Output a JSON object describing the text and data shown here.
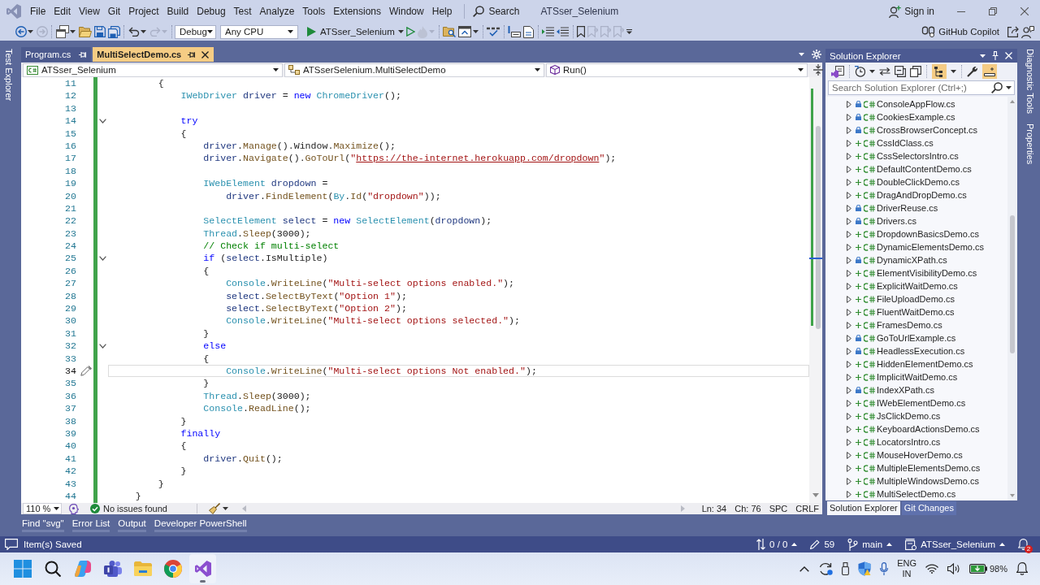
{
  "window": {
    "title": "ATSser_Selenium"
  },
  "menu": [
    "File",
    "Edit",
    "View",
    "Git",
    "Project",
    "Build",
    "Debug",
    "Test",
    "Analyze",
    "Tools",
    "Extensions",
    "Window",
    "Help"
  ],
  "search": {
    "label": "Search"
  },
  "account": {
    "label": "Sign in"
  },
  "toolbar": {
    "configuration": "Debug",
    "platform": "Any CPU",
    "start": "ATSser_Selenium",
    "copilot": "GitHub Copilot"
  },
  "side_tabs": {
    "left": [
      "Test Explorer"
    ],
    "right": [
      "Diagnostic Tools",
      "Properties"
    ]
  },
  "editor": {
    "tabs": [
      {
        "label": "Program.cs",
        "selected": false
      },
      {
        "label": "MultiSelectDemo.cs",
        "selected": true
      }
    ],
    "navigation": {
      "project": "ATSser_Selenium",
      "type": "ATSserSelenium.MultiSelectDemo",
      "member": "Run()"
    },
    "lines": [
      {
        "number": "11",
        "current": false,
        "tokens": [
          {
            "kind": "plain",
            "text": "        {"
          }
        ]
      },
      {
        "number": "12",
        "current": false,
        "tokens": [
          {
            "kind": "type",
            "text": "            IWebDriver"
          },
          {
            "kind": "variable",
            "text": " driver"
          },
          {
            "kind": "plain",
            "text": " = "
          },
          {
            "kind": "keyword",
            "text": "new"
          },
          {
            "kind": "type",
            "text": " ChromeDriver"
          },
          {
            "kind": "plain",
            "text": "();"
          }
        ]
      },
      {
        "number": "13",
        "current": false
      },
      {
        "number": "14",
        "current": false,
        "expanded": true,
        "tokens": [
          {
            "kind": "keyword",
            "text": "            try"
          }
        ]
      },
      {
        "number": "15",
        "current": false,
        "tokens": [
          {
            "kind": "plain",
            "text": "            {"
          }
        ]
      },
      {
        "number": "16",
        "current": false,
        "tokens": [
          {
            "kind": "variable",
            "text": "                driver"
          },
          {
            "kind": "plain",
            "text": "."
          },
          {
            "kind": "method",
            "text": "Manage"
          },
          {
            "kind": "plain",
            "text": "().Window."
          },
          {
            "kind": "method",
            "text": "Maximize"
          },
          {
            "kind": "plain",
            "text": "();"
          }
        ]
      },
      {
        "number": "17",
        "current": false,
        "tokens": [
          {
            "kind": "variable",
            "text": "                driver"
          },
          {
            "kind": "plain",
            "text": "."
          },
          {
            "kind": "method",
            "text": "Navigate"
          },
          {
            "kind": "plain",
            "text": "()."
          },
          {
            "kind": "method",
            "text": "GoToUrl"
          },
          {
            "kind": "plain",
            "text": "("
          },
          {
            "kind": "string",
            "text": "\""
          },
          {
            "kind": "url",
            "text": "https://the-internet.herokuapp.com/dropdown"
          },
          {
            "kind": "string",
            "text": "\""
          },
          {
            "kind": "plain",
            "text": ");"
          }
        ]
      },
      {
        "number": "18",
        "current": false
      },
      {
        "number": "19",
        "current": false,
        "tokens": [
          {
            "kind": "type",
            "text": "                IWebElement"
          },
          {
            "kind": "variable",
            "text": " dropdown"
          },
          {
            "kind": "plain",
            "text": " ="
          }
        ]
      },
      {
        "number": "20",
        "current": false,
        "tokens": [
          {
            "kind": "variable",
            "text": "                    driver"
          },
          {
            "kind": "plain",
            "text": "."
          },
          {
            "kind": "method",
            "text": "FindElement"
          },
          {
            "kind": "plain",
            "text": "("
          },
          {
            "kind": "type",
            "text": "By"
          },
          {
            "kind": "plain",
            "text": "."
          },
          {
            "kind": "method",
            "text": "Id"
          },
          {
            "kind": "plain",
            "text": "("
          },
          {
            "kind": "string",
            "text": "\"dropdown\""
          },
          {
            "kind": "plain",
            "text": "));"
          }
        ]
      },
      {
        "number": "21",
        "current": false
      },
      {
        "number": "22",
        "current": false,
        "tokens": [
          {
            "kind": "type",
            "text": "                SelectElement"
          },
          {
            "kind": "variable",
            "text": " select"
          },
          {
            "kind": "plain",
            "text": " = "
          },
          {
            "kind": "keyword",
            "text": "new"
          },
          {
            "kind": "type",
            "text": " SelectElement"
          },
          {
            "kind": "plain",
            "text": "("
          },
          {
            "kind": "variable",
            "text": "dropdown"
          },
          {
            "kind": "plain",
            "text": ");"
          }
        ]
      },
      {
        "number": "23",
        "current": false,
        "tokens": [
          {
            "kind": "type",
            "text": "                Thread"
          },
          {
            "kind": "plain",
            "text": "."
          },
          {
            "kind": "method",
            "text": "Sleep"
          },
          {
            "kind": "plain",
            "text": "("
          },
          {
            "kind": "number",
            "text": "3000"
          },
          {
            "kind": "plain",
            "text": ");"
          }
        ]
      },
      {
        "number": "24",
        "current": false,
        "tokens": [
          {
            "kind": "comment",
            "text": "                // Check if multi-select"
          }
        ]
      },
      {
        "number": "25",
        "current": false,
        "expanded": true,
        "tokens": [
          {
            "kind": "keyword",
            "text": "                if"
          },
          {
            "kind": "plain",
            "text": " ("
          },
          {
            "kind": "variable",
            "text": "select"
          },
          {
            "kind": "plain",
            "text": ".IsMultiple)"
          }
        ]
      },
      {
        "number": "26",
        "current": false,
        "tokens": [
          {
            "kind": "plain",
            "text": "                {"
          }
        ]
      },
      {
        "number": "27",
        "current": false,
        "tokens": [
          {
            "kind": "type",
            "text": "                    Console"
          },
          {
            "kind": "plain",
            "text": "."
          },
          {
            "kind": "method",
            "text": "WriteLine"
          },
          {
            "kind": "plain",
            "text": "("
          },
          {
            "kind": "string",
            "text": "\"Multi-select options enabled.\""
          },
          {
            "kind": "plain",
            "text": ");"
          }
        ]
      },
      {
        "number": "28",
        "current": false,
        "tokens": [
          {
            "kind": "variable",
            "text": "                    select"
          },
          {
            "kind": "plain",
            "text": "."
          },
          {
            "kind": "method",
            "text": "SelectByText"
          },
          {
            "kind": "plain",
            "text": "("
          },
          {
            "kind": "string",
            "text": "\"Option 1\""
          },
          {
            "kind": "plain",
            "text": ");"
          }
        ]
      },
      {
        "number": "29",
        "current": false,
        "tokens": [
          {
            "kind": "variable",
            "text": "                    select"
          },
          {
            "kind": "plain",
            "text": "."
          },
          {
            "kind": "method",
            "text": "SelectByText"
          },
          {
            "kind": "plain",
            "text": "("
          },
          {
            "kind": "string",
            "text": "\"Option 2\""
          },
          {
            "kind": "plain",
            "text": ");"
          }
        ]
      },
      {
        "number": "30",
        "current": false,
        "tokens": [
          {
            "kind": "type",
            "text": "                    Console"
          },
          {
            "kind": "plain",
            "text": "."
          },
          {
            "kind": "method",
            "text": "WriteLine"
          },
          {
            "kind": "plain",
            "text": "("
          },
          {
            "kind": "string",
            "text": "\"Multi-select options selected.\""
          },
          {
            "kind": "plain",
            "text": ");"
          }
        ]
      },
      {
        "number": "31",
        "current": false,
        "tokens": [
          {
            "kind": "plain",
            "text": "                }"
          }
        ]
      },
      {
        "number": "32",
        "current": false,
        "expanded": true,
        "tokens": [
          {
            "kind": "keyword",
            "text": "                else"
          }
        ]
      },
      {
        "number": "33",
        "current": false,
        "tokens": [
          {
            "kind": "plain",
            "text": "                {"
          }
        ]
      },
      {
        "number": "34",
        "current": true,
        "tokens": [
          {
            "kind": "type",
            "text": "                    Console"
          },
          {
            "kind": "plain",
            "text": "."
          },
          {
            "kind": "method",
            "text": "WriteLine"
          },
          {
            "kind": "plain",
            "text": "("
          },
          {
            "kind": "string",
            "text": "\"Multi-select options Not enabled.\""
          },
          {
            "kind": "plain",
            "text": ");"
          }
        ]
      },
      {
        "number": "35",
        "current": false,
        "tokens": [
          {
            "kind": "plain",
            "text": "                }"
          }
        ]
      },
      {
        "number": "36",
        "current": false,
        "tokens": [
          {
            "kind": "type",
            "text": "                Thread"
          },
          {
            "kind": "plain",
            "text": "."
          },
          {
            "kind": "method",
            "text": "Sleep"
          },
          {
            "kind": "plain",
            "text": "("
          },
          {
            "kind": "number",
            "text": "3000"
          },
          {
            "kind": "plain",
            "text": ");"
          }
        ]
      },
      {
        "number": "37",
        "current": false,
        "tokens": [
          {
            "kind": "type",
            "text": "                Console"
          },
          {
            "kind": "plain",
            "text": "."
          },
          {
            "kind": "method",
            "text": "ReadLine"
          },
          {
            "kind": "plain",
            "text": "();"
          }
        ]
      },
      {
        "number": "38",
        "current": false,
        "tokens": [
          {
            "kind": "plain",
            "text": "            }"
          }
        ]
      },
      {
        "number": "39",
        "current": false,
        "tokens": [
          {
            "kind": "keyword",
            "text": "            finally"
          }
        ]
      },
      {
        "number": "40",
        "current": false,
        "tokens": [
          {
            "kind": "plain",
            "text": "            {"
          }
        ]
      },
      {
        "number": "41",
        "current": false,
        "tokens": [
          {
            "kind": "variable",
            "text": "                driver"
          },
          {
            "kind": "plain",
            "text": "."
          },
          {
            "kind": "method",
            "text": "Quit"
          },
          {
            "kind": "plain",
            "text": "();"
          }
        ]
      },
      {
        "number": "42",
        "current": false,
        "tokens": [
          {
            "kind": "plain",
            "text": "            }"
          }
        ]
      },
      {
        "number": "43",
        "current": false,
        "tokens": [
          {
            "kind": "plain",
            "text": "        }"
          }
        ]
      },
      {
        "number": "44",
        "current": false,
        "tokens": [
          {
            "kind": "plain",
            "text": "    }"
          }
        ]
      }
    ],
    "status": {
      "zoom": "110 %",
      "issues": "No issues found",
      "line": "Ln: 34",
      "column": "Ch: 76",
      "whitespace": "SPC",
      "line_endings": "CRLF"
    }
  },
  "solution_explorer": {
    "title": "Solution Explorer",
    "search": {
      "placeholder": "Search Solution Explorer (Ctrl+;)"
    },
    "items": [
      {
        "name": "ConsoleAppFlow.cs",
        "kind": "unchanged",
        "expanded": false
      },
      {
        "name": "CookiesExample.cs",
        "kind": "unchanged",
        "expanded": false
      },
      {
        "name": "CrossBrowserConcept.cs",
        "kind": "unchanged",
        "expanded": false
      },
      {
        "name": "CssIdClass.cs",
        "kind": "added",
        "expanded": false
      },
      {
        "name": "CssSelectorsIntro.cs",
        "kind": "added",
        "expanded": false
      },
      {
        "name": "DefaultContentDemo.cs",
        "kind": "added",
        "expanded": false
      },
      {
        "name": "DoubleClickDemo.cs",
        "kind": "added",
        "expanded": false
      },
      {
        "name": "DragAndDropDemo.cs",
        "kind": "added",
        "expanded": false
      },
      {
        "name": "DriverReuse.cs",
        "kind": "unchanged",
        "expanded": false
      },
      {
        "name": "Drivers.cs",
        "kind": "unchanged",
        "expanded": false
      },
      {
        "name": "DropdownBasicsDemo.cs",
        "kind": "added",
        "expanded": false
      },
      {
        "name": "DynamicElementsDemo.cs",
        "kind": "added",
        "expanded": false
      },
      {
        "name": "DynamicXPath.cs",
        "kind": "unchanged",
        "expanded": false
      },
      {
        "name": "ElementVisibilityDemo.cs",
        "kind": "added",
        "expanded": false
      },
      {
        "name": "ExplicitWaitDemo.cs",
        "kind": "added",
        "expanded": false
      },
      {
        "name": "FileUploadDemo.cs",
        "kind": "added",
        "expanded": false
      },
      {
        "name": "FluentWaitDemo.cs",
        "kind": "added",
        "expanded": false
      },
      {
        "name": "FramesDemo.cs",
        "kind": "added",
        "expanded": false
      },
      {
        "name": "GoToUrlExample.cs",
        "kind": "unchanged",
        "expanded": false
      },
      {
        "name": "HeadlessExecution.cs",
        "kind": "unchanged",
        "expanded": false
      },
      {
        "name": "HiddenElementDemo.cs",
        "kind": "added",
        "expanded": false
      },
      {
        "name": "ImplicitWaitDemo.cs",
        "kind": "added",
        "expanded": false
      },
      {
        "name": "IndexXPath.cs",
        "kind": "unchanged",
        "expanded": false
      },
      {
        "name": "IWebElementDemo.cs",
        "kind": "added",
        "expanded": false
      },
      {
        "name": "JsClickDemo.cs",
        "kind": "added",
        "expanded": false
      },
      {
        "name": "KeyboardActionsDemo.cs",
        "kind": "added",
        "expanded": false
      },
      {
        "name": "LocatorsIntro.cs",
        "kind": "added",
        "expanded": false
      },
      {
        "name": "MouseHoverDemo.cs",
        "kind": "added",
        "expanded": false
      },
      {
        "name": "MultipleElementsDemo.cs",
        "kind": "added",
        "expanded": false
      },
      {
        "name": "MultipleWindowsDemo.cs",
        "kind": "added",
        "expanded": false
      },
      {
        "name": "MultiSelectDemo.cs",
        "kind": "added",
        "expanded": false
      }
    ],
    "tabs": [
      {
        "label": "Solution Explorer",
        "selected": true
      },
      {
        "label": "Git Changes",
        "selected": false
      }
    ]
  },
  "tool_tabs": [
    "Find \"svg\"",
    "Error List",
    "Output",
    "Developer PowerShell"
  ],
  "status_bar": {
    "message": "Item(s) Saved",
    "sync": "0 / 0",
    "changes": "59",
    "branch": "main",
    "repository": "ATSser_Selenium",
    "notifications": "2"
  },
  "taskbar": {
    "apps": [
      {
        "active": false
      },
      {
        "active": false
      },
      {
        "active": false
      },
      {
        "active": false
      },
      {
        "active": false
      },
      {
        "active": false
      },
      {
        "active": true
      }
    ],
    "tray": {
      "language": "ENG",
      "region": "IN",
      "battery": "98%"
    }
  }
}
